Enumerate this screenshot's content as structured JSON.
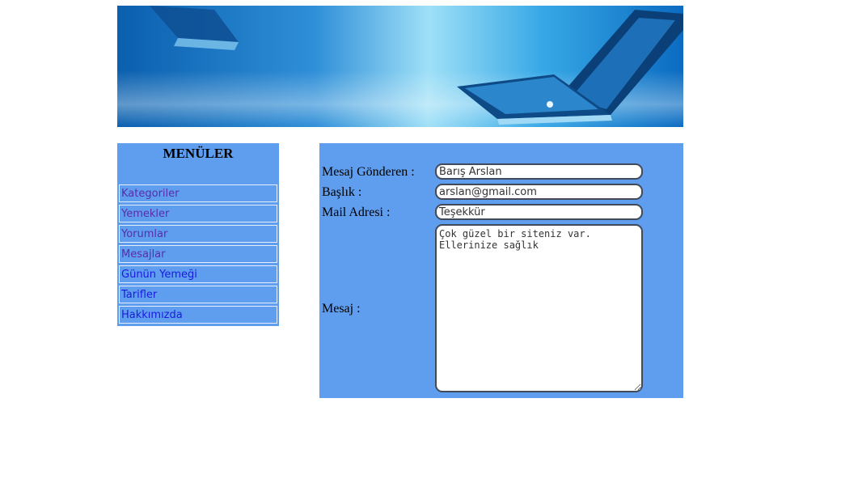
{
  "menu": {
    "title": "MENÜLER",
    "items": [
      {
        "label": "Kategoriler",
        "state": "visited"
      },
      {
        "label": "Yemekler",
        "state": "visited"
      },
      {
        "label": "Yorumlar",
        "state": "visited"
      },
      {
        "label": "Mesajlar",
        "state": "visited"
      },
      {
        "label": "Günün Yemeği",
        "state": "link"
      },
      {
        "label": "Tarifler",
        "state": "link"
      },
      {
        "label": "Hakkımızda",
        "state": "link"
      }
    ]
  },
  "form": {
    "sender_label": "Mesaj Gönderen :",
    "sender_value": "Barış Arslan",
    "title_label": "Başlık :",
    "title_value": "arslan@gmail.com",
    "mail_label": "Mail Adresi :",
    "mail_value": "Teşekkür",
    "message_label": "Mesaj :",
    "message_value": "Çok güzel bir siteniz var.\nEllerinize sağlık"
  },
  "colors": {
    "panel_bg": "#5f9eef",
    "visited_link": "#5a2bab",
    "link": "#1a1adf"
  }
}
